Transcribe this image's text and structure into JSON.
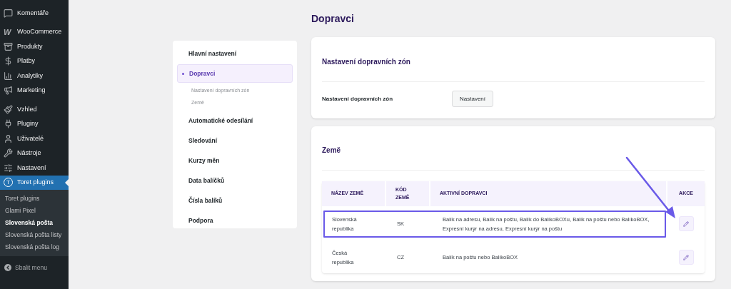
{
  "admin_menu": {
    "groups": [
      [
        {
          "label": "Komentáře",
          "selected": false
        }
      ],
      [
        {
          "label": "WooCommerce",
          "logo_text": "W",
          "selected": false
        },
        {
          "label": "Produkty",
          "selected": false
        },
        {
          "label": "Platby",
          "selected": false
        },
        {
          "label": "Analytiky",
          "selected": false
        },
        {
          "label": "Marketing",
          "selected": false
        }
      ],
      [
        {
          "label": "Vzhled",
          "selected": false
        },
        {
          "label": "Pluginy",
          "selected": false
        },
        {
          "label": "Uživatelé",
          "selected": false
        },
        {
          "label": "Nástroje",
          "selected": false
        },
        {
          "label": "Nastavení",
          "selected": false
        },
        {
          "label": "Toret plugins",
          "logo_text": "T",
          "selected": true,
          "children": [
            {
              "label": "Toret plugins",
              "selected": false
            },
            {
              "label": "Glami Pixel",
              "selected": false
            },
            {
              "label": "Slovenská pošta",
              "selected": true
            },
            {
              "label": "Slovenská pošta listy",
              "selected": false
            },
            {
              "label": "Slovenská pošta log",
              "selected": false
            }
          ]
        }
      ]
    ],
    "collapse": "Sbalit menu"
  },
  "page_title": "Dopravci",
  "settings_nav": [
    {
      "label": "Hlavní nastavení",
      "selected": false
    },
    {
      "label": "Dopravci",
      "selected": true,
      "children": [
        {
          "label": "Nastavení dopravních zón"
        },
        {
          "label": "Země"
        }
      ]
    },
    {
      "label": "Automatické odesílání",
      "selected": false
    },
    {
      "label": "Sledování",
      "selected": false
    },
    {
      "label": "Kurzy měn",
      "selected": false
    },
    {
      "label": "Data balíčků",
      "selected": false
    },
    {
      "label": "Čísla balíků",
      "selected": false
    },
    {
      "label": "Podpora",
      "selected": false
    }
  ],
  "zones_card": {
    "title": "Nastavení dopravních zón",
    "row_label": "Nastavení dopravních zón",
    "button": "Nastavení"
  },
  "countries_card": {
    "title": "Země",
    "table": {
      "columns": [
        "NÁZEV ZEMĚ",
        "KÓD ZEMĚ",
        "AKTIVNÍ DOPRAVCI",
        "AKCE"
      ],
      "rows": [
        {
          "name": "Slovenská republika",
          "code": "SK",
          "carriers": "Balík na adresu, Balík na poštu, Balík do BalíkoBOXu, Balík na poštu nebo BalíkoBOX, Expresní kurýr na adresu, Expresní kurýr na poštu",
          "highlighted": true
        },
        {
          "name": "Česká republika",
          "code": "CZ",
          "carriers": "Balík na poštu nebo BalíkoBOX",
          "highlighted": false
        }
      ]
    }
  }
}
